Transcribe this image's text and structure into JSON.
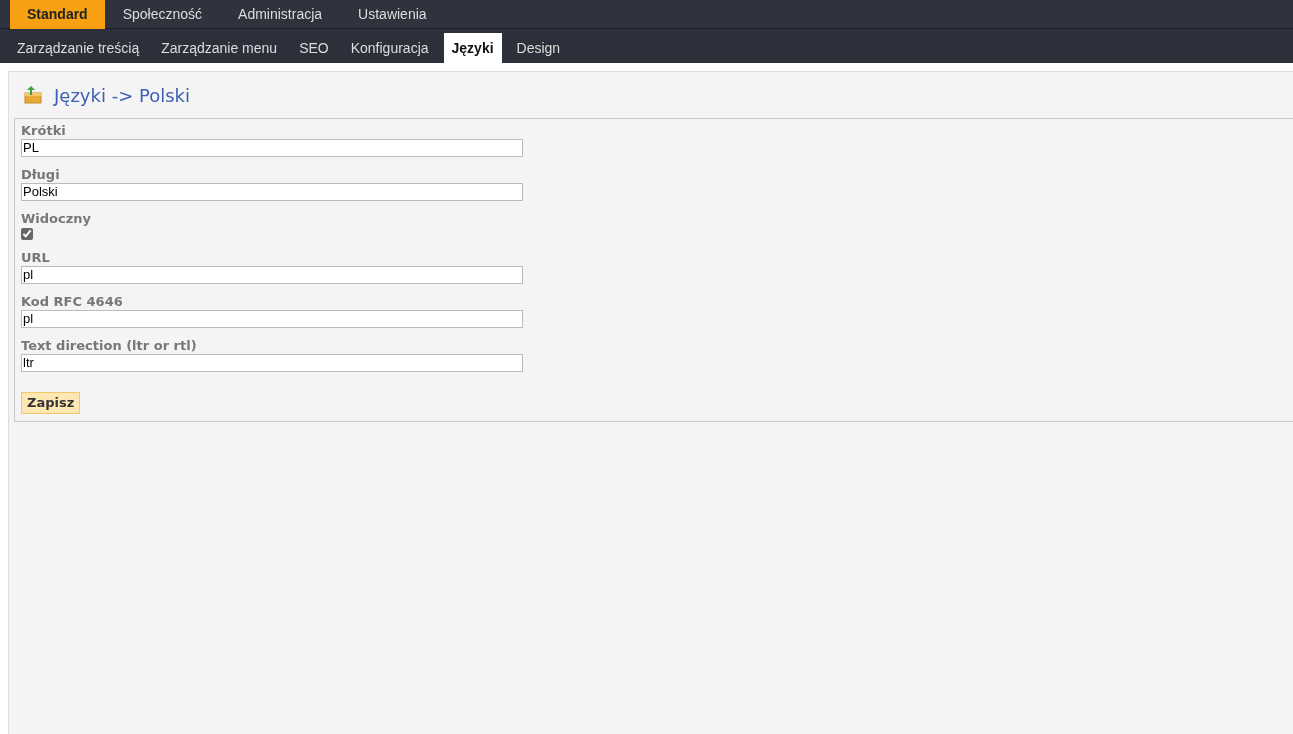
{
  "main_menu": [
    {
      "label": "Standard",
      "selected": true
    },
    {
      "label": "Społeczność",
      "selected": false
    },
    {
      "label": "Administracja",
      "selected": false
    },
    {
      "label": "Ustawienia",
      "selected": false
    }
  ],
  "sub_menu": [
    {
      "label": "Zarządzanie treścią",
      "selected": false
    },
    {
      "label": "Zarządzanie menu",
      "selected": false
    },
    {
      "label": "SEO",
      "selected": false
    },
    {
      "label": "Konfiguracja",
      "selected": false
    },
    {
      "label": "Języki",
      "selected": true
    },
    {
      "label": "Design",
      "selected": false
    }
  ],
  "page_title": "Języki -> Polski",
  "fields": [
    {
      "kind": "text",
      "label": "Krótki",
      "value": "PL"
    },
    {
      "kind": "text",
      "label": "Długi",
      "value": "Polski"
    },
    {
      "kind": "checkbox",
      "label": "Widoczny",
      "checked": true
    },
    {
      "kind": "text",
      "label": "URL",
      "value": "pl"
    },
    {
      "kind": "text",
      "label": "Kod RFC 4646",
      "value": "pl"
    },
    {
      "kind": "text",
      "label": "Text direction (ltr or rtl)",
      "value": "ltr"
    }
  ],
  "save_button": "Zapisz"
}
